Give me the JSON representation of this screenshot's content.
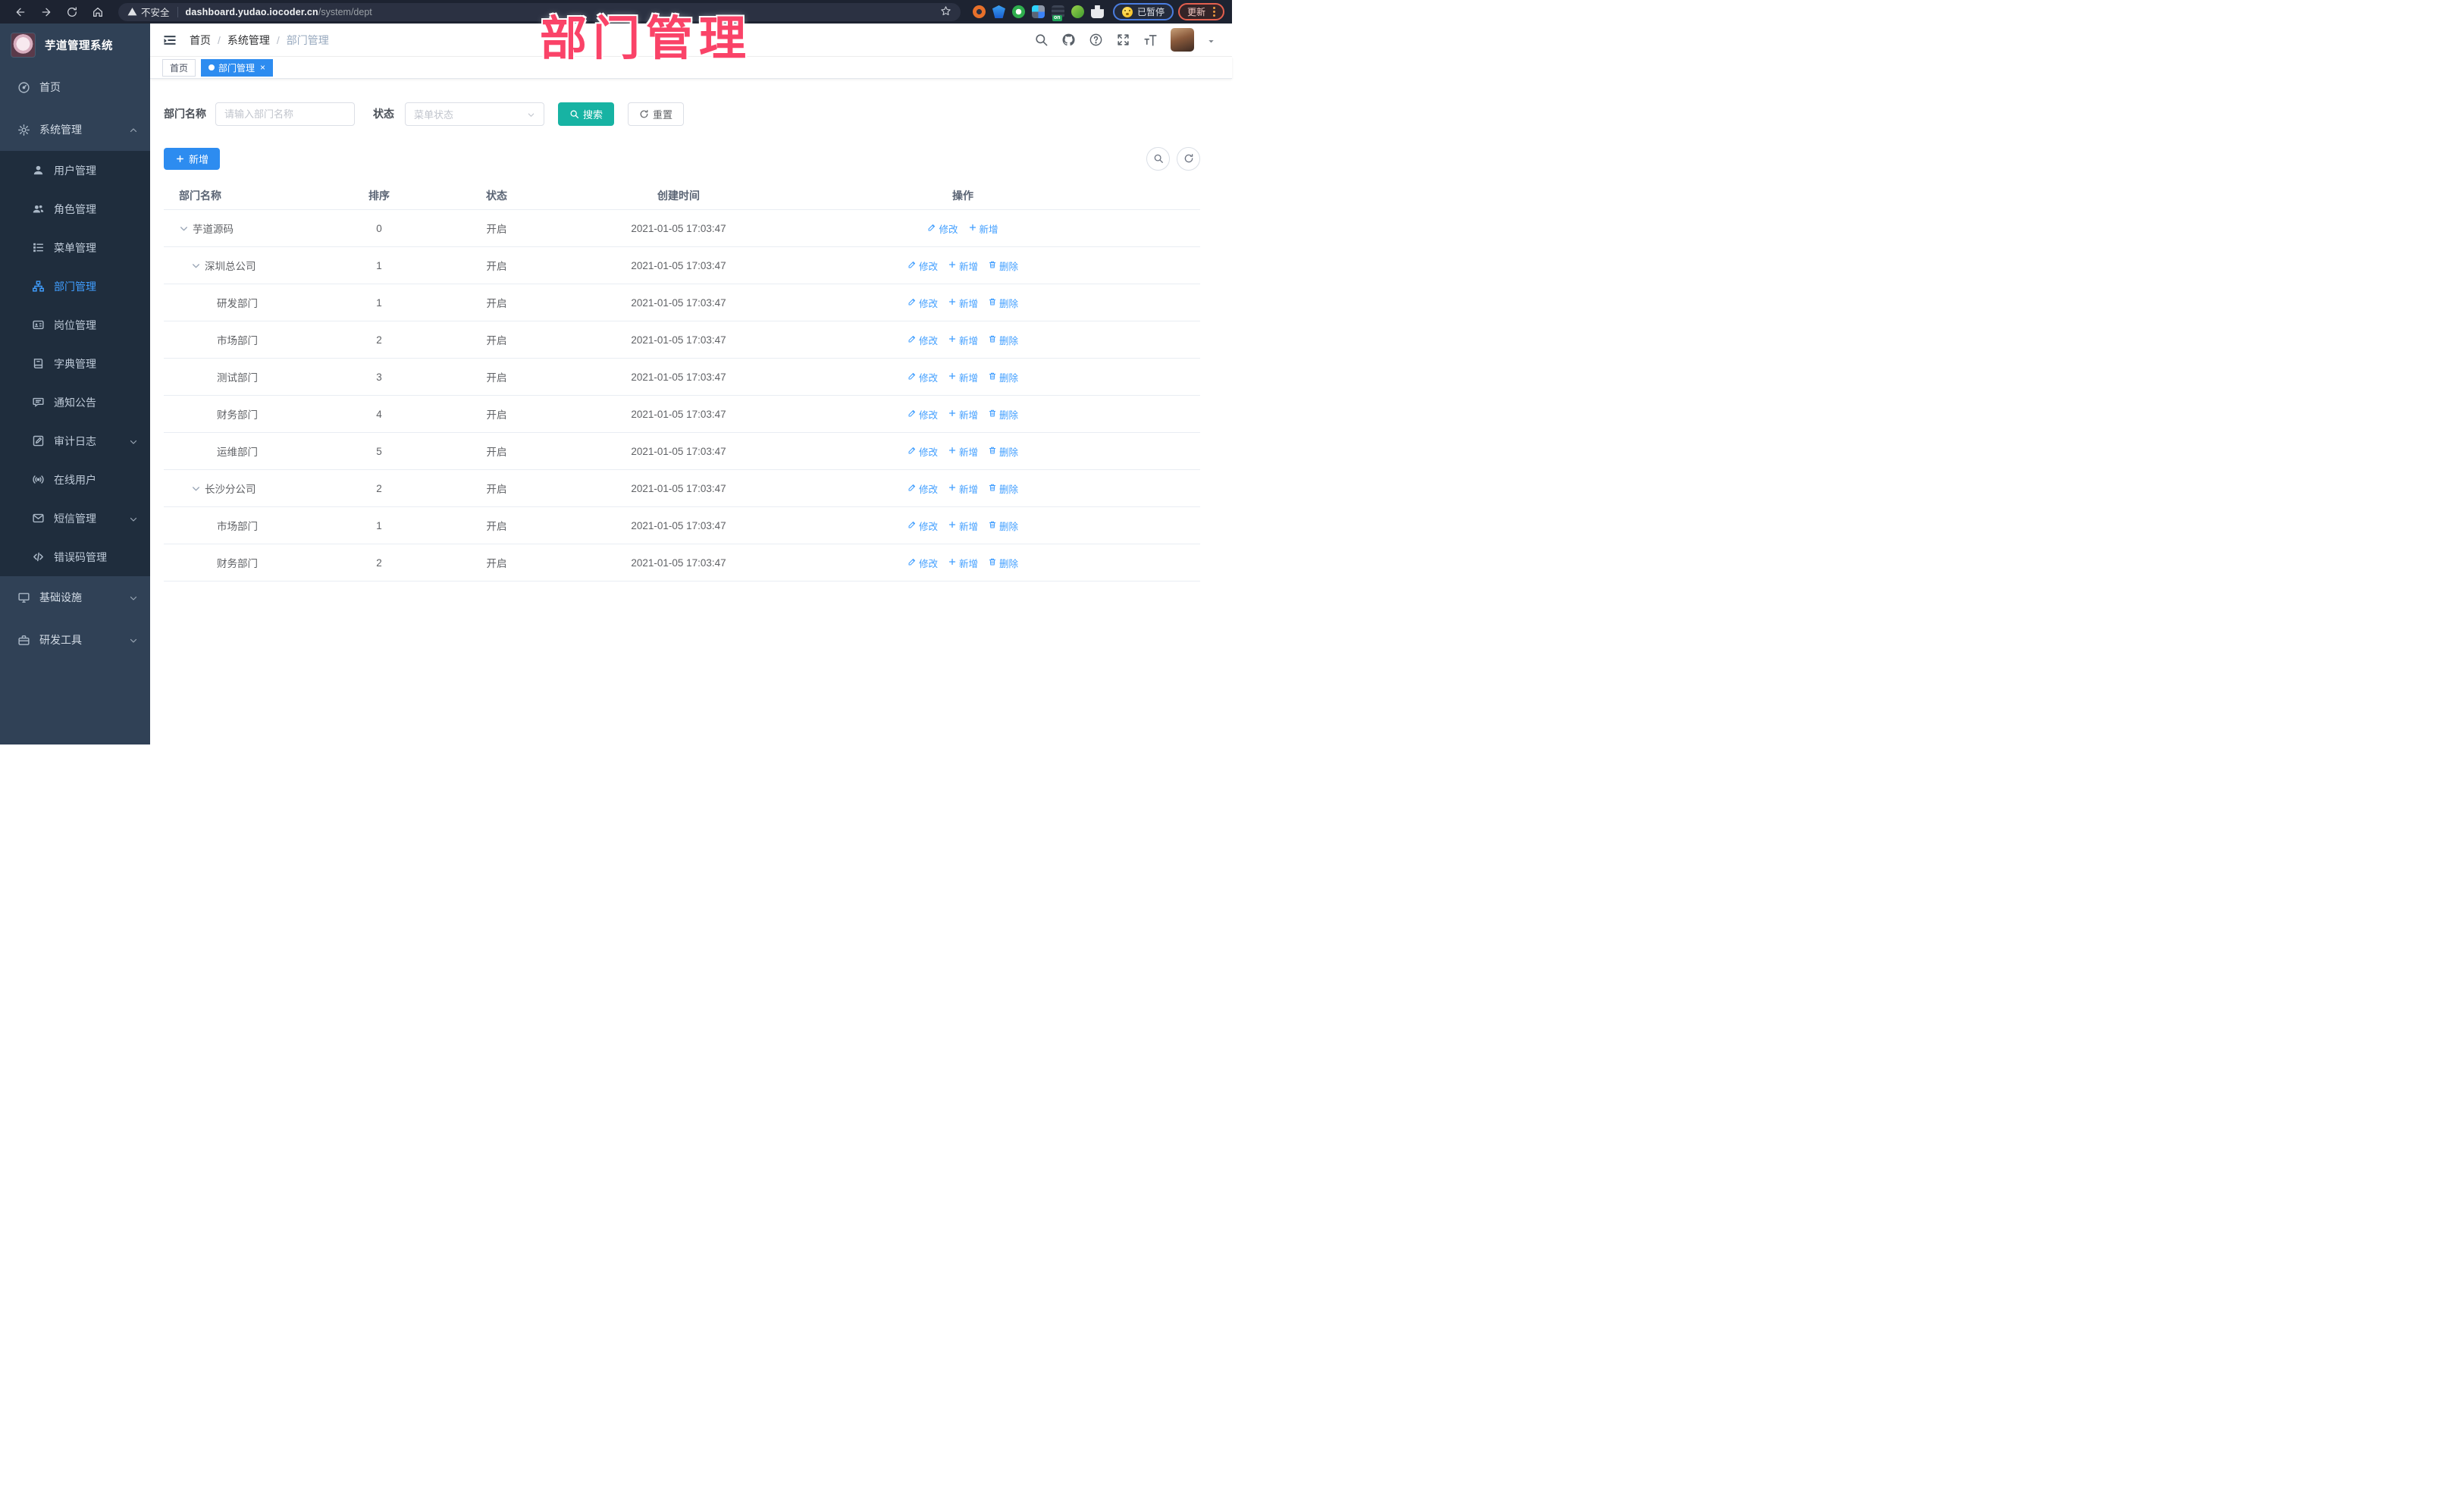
{
  "browser": {
    "security_label": "不安全",
    "url_host": "dashboard.yudao.iocoder.cn",
    "url_path": "/system/dept",
    "extension_badge": "on",
    "paused_badge": "已暂停",
    "update_button": "更新"
  },
  "annotation": {
    "title": "部门管理"
  },
  "sidebar": {
    "logo_title": "芋道管理系统",
    "menu": [
      {
        "label": "首页",
        "icon": "dashboard-icon"
      },
      {
        "label": "系统管理",
        "icon": "gear-icon",
        "chevron": "up",
        "open": true,
        "children": [
          {
            "label": "用户管理",
            "icon": "user-icon"
          },
          {
            "label": "角色管理",
            "icon": "users-icon"
          },
          {
            "label": "菜单管理",
            "icon": "menu-list-icon"
          },
          {
            "label": "部门管理",
            "icon": "org-tree-icon",
            "active": true
          },
          {
            "label": "岗位管理",
            "icon": "id-card-icon"
          },
          {
            "label": "字典管理",
            "icon": "book-icon"
          },
          {
            "label": "通知公告",
            "icon": "megaphone-icon"
          },
          {
            "label": "审计日志",
            "icon": "edit-square-icon",
            "chevron": "down"
          },
          {
            "label": "在线用户",
            "icon": "online-icon"
          },
          {
            "label": "短信管理",
            "icon": "message-icon",
            "chevron": "down"
          },
          {
            "label": "错误码管理",
            "icon": "code-icon"
          }
        ]
      },
      {
        "label": "基础设施",
        "icon": "monitor-icon",
        "chevron": "down"
      },
      {
        "label": "研发工具",
        "icon": "toolbox-icon",
        "chevron": "down"
      }
    ]
  },
  "navbar": {
    "breadcrumb": [
      {
        "label": "首页"
      },
      {
        "label": "系统管理"
      },
      {
        "label": "部门管理",
        "current": true
      }
    ]
  },
  "tags": [
    {
      "label": "首页"
    },
    {
      "label": "部门管理",
      "active": true,
      "closable": true
    }
  ],
  "filters": {
    "dept_label": "部门名称",
    "dept_placeholder": "请输入部门名称",
    "status_label": "状态",
    "status_placeholder": "菜单状态",
    "search_button": "搜索",
    "reset_button": "重置"
  },
  "toolbar": {
    "add_button": "新增"
  },
  "table": {
    "columns": [
      {
        "label": "部门名称",
        "align": "left"
      },
      {
        "label": "排序",
        "align": "center"
      },
      {
        "label": "状态",
        "align": "center"
      },
      {
        "label": "创建时间",
        "align": "center"
      },
      {
        "label": "操作",
        "align": "center"
      }
    ],
    "action_labels": {
      "edit": "修改",
      "add": "新增",
      "delete": "删除"
    },
    "rows": [
      {
        "name": "芋道源码",
        "level": 0,
        "expandable": true,
        "sort": "0",
        "status": "开启",
        "created": "2021-01-05 17:03:47",
        "actions": [
          "edit",
          "add"
        ]
      },
      {
        "name": "深圳总公司",
        "level": 1,
        "expandable": true,
        "sort": "1",
        "status": "开启",
        "created": "2021-01-05 17:03:47",
        "actions": [
          "edit",
          "add",
          "delete"
        ]
      },
      {
        "name": "研发部门",
        "level": 2,
        "expandable": false,
        "sort": "1",
        "status": "开启",
        "created": "2021-01-05 17:03:47",
        "actions": [
          "edit",
          "add",
          "delete"
        ]
      },
      {
        "name": "市场部门",
        "level": 2,
        "expandable": false,
        "sort": "2",
        "status": "开启",
        "created": "2021-01-05 17:03:47",
        "actions": [
          "edit",
          "add",
          "delete"
        ]
      },
      {
        "name": "测试部门",
        "level": 2,
        "expandable": false,
        "sort": "3",
        "status": "开启",
        "created": "2021-01-05 17:03:47",
        "actions": [
          "edit",
          "add",
          "delete"
        ]
      },
      {
        "name": "财务部门",
        "level": 2,
        "expandable": false,
        "sort": "4",
        "status": "开启",
        "created": "2021-01-05 17:03:47",
        "actions": [
          "edit",
          "add",
          "delete"
        ]
      },
      {
        "name": "运维部门",
        "level": 2,
        "expandable": false,
        "sort": "5",
        "status": "开启",
        "created": "2021-01-05 17:03:47",
        "actions": [
          "edit",
          "add",
          "delete"
        ]
      },
      {
        "name": "长沙分公司",
        "level": 1,
        "expandable": true,
        "sort": "2",
        "status": "开启",
        "created": "2021-01-05 17:03:47",
        "actions": [
          "edit",
          "add",
          "delete"
        ]
      },
      {
        "name": "市场部门",
        "level": 2,
        "expandable": false,
        "sort": "1",
        "status": "开启",
        "created": "2021-01-05 17:03:47",
        "actions": [
          "edit",
          "add",
          "delete"
        ]
      },
      {
        "name": "财务部门",
        "level": 2,
        "expandable": false,
        "sort": "2",
        "status": "开启",
        "created": "2021-01-05 17:03:47",
        "actions": [
          "edit",
          "add",
          "delete"
        ]
      }
    ]
  },
  "colors": {
    "primary_blue": "#2d8cf0",
    "link_blue": "#409eff",
    "search_teal": "#17b3a3",
    "sidebar_bg": "#304156",
    "submenu_bg": "#1f2d3d",
    "annotation_pink": "#fa4368"
  }
}
